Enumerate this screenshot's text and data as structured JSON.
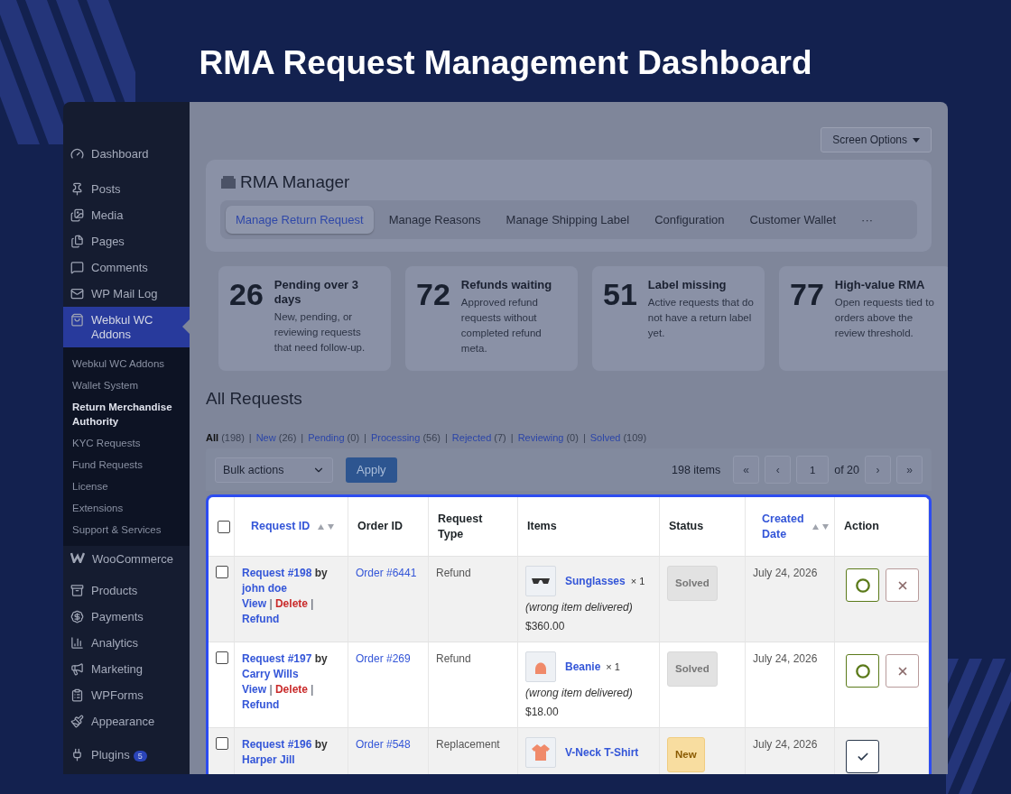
{
  "headline": "RMA Request Management Dashboard",
  "sidebar": {
    "items": [
      {
        "label": "Dashboard",
        "selected": false
      },
      {
        "label": "Posts",
        "selected": false
      },
      {
        "label": "Media",
        "selected": false
      },
      {
        "label": "Pages",
        "selected": false
      },
      {
        "label": "Comments",
        "selected": false
      },
      {
        "label": "WP Mail Log",
        "selected": false
      },
      {
        "label": "Webkul WC Addons",
        "selected": true,
        "children": [
          {
            "label": "Webkul WC Addons",
            "selected": false
          },
          {
            "label": "Wallet System",
            "selected": false
          },
          {
            "label": "Return Merchandise Authority",
            "selected": true
          },
          {
            "label": "KYC Requests",
            "selected": false
          },
          {
            "label": "Fund Requests",
            "selected": false
          },
          {
            "label": "License",
            "selected": false
          },
          {
            "label": "Extensions",
            "selected": false
          },
          {
            "label": "Support & Services",
            "selected": false
          }
        ]
      },
      {
        "label": "WooCommerce",
        "selected": false
      },
      {
        "label": "Products",
        "selected": false
      },
      {
        "label": "Payments",
        "selected": false
      },
      {
        "label": "Analytics",
        "selected": false
      },
      {
        "label": "Marketing",
        "selected": false
      },
      {
        "label": "WPForms",
        "selected": false
      },
      {
        "label": "Appearance",
        "selected": false
      },
      {
        "label": "Plugins",
        "selected": false,
        "badge": "5"
      }
    ]
  },
  "screen_options": "Screen Options",
  "manager": {
    "title": "RMA Manager",
    "tabs": [
      {
        "label": "Manage Return Request",
        "selected": true
      },
      {
        "label": "Manage Reasons",
        "selected": false
      },
      {
        "label": "Manage Shipping Label",
        "selected": false
      },
      {
        "label": "Configuration",
        "selected": false
      },
      {
        "label": "Customer Wallet",
        "selected": false
      },
      {
        "label": "···",
        "selected": false
      }
    ]
  },
  "stats": [
    {
      "value": "26",
      "title": "Pending over 3 days",
      "description": "New, pending, or reviewing requests that need follow-up."
    },
    {
      "value": "72",
      "title": "Refunds waiting",
      "description": "Approved refund requests without completed refund meta."
    },
    {
      "value": "51",
      "title": "Label missing",
      "description": "Active requests that do not have a return label yet."
    },
    {
      "value": "77",
      "title": "High-value RMA",
      "description": "Open requests tied to orders above the review threshold."
    }
  ],
  "section_title": "All Requests",
  "filters": [
    {
      "label": "All",
      "count": "(198)",
      "selected": true
    },
    {
      "separator": "|",
      "label": "New",
      "count": "(26)",
      "selected": false
    },
    {
      "separator": "|",
      "label": "Pending",
      "count": "(0)",
      "selected": false
    },
    {
      "separator": "|",
      "label": "Processing",
      "count": "(56)",
      "selected": false
    },
    {
      "separator": "|",
      "label": "Rejected",
      "count": "(7)",
      "selected": false
    },
    {
      "separator": "|",
      "label": "Reviewing",
      "count": "(0)",
      "selected": false
    },
    {
      "separator": "|",
      "label": "Solved",
      "count": "(109)",
      "selected": false
    }
  ],
  "toolbar": {
    "bulk_actions": "Bulk actions",
    "apply": "Apply",
    "items_count": "198 items",
    "pagination": {
      "first": "«",
      "prev": "‹",
      "page": "1",
      "of": "of 20",
      "next": "›",
      "last": "»"
    }
  },
  "table": {
    "select_all_checked": false,
    "columns": [
      {
        "label": "Request ID",
        "sortable": true
      },
      {
        "label": "Order ID",
        "sortable": false
      },
      {
        "label": "Request Type",
        "sortable": false
      },
      {
        "label": "Items",
        "sortable": false
      },
      {
        "label": "Status",
        "sortable": false
      },
      {
        "label": "Created Date",
        "sortable": true
      },
      {
        "label": "Action",
        "sortable": false
      }
    ],
    "rows": [
      {
        "checked": false,
        "request": "Request #198",
        "by": "by",
        "customer": "john doe",
        "links": [
          {
            "label": "View",
            "kind": "link",
            "after": "|"
          },
          {
            "label": "Delete",
            "kind": "danger",
            "after": "|"
          },
          {
            "label": "Refund",
            "kind": "link"
          }
        ],
        "order": "Order #6441",
        "type": "Refund",
        "item": "Sunglasses",
        "qty": "× 1",
        "reason": "(wrong item delivered)",
        "price": "$360.00",
        "status": {
          "label": "Solved",
          "kind": "solved"
        },
        "date": "July 24, 2026",
        "actions": [
          {
            "kind": "approve"
          },
          {
            "kind": "reject"
          }
        ]
      },
      {
        "checked": false,
        "request": "Request #197",
        "by": "by",
        "customer": "Carry Wills",
        "links": [
          {
            "label": "View",
            "kind": "link",
            "after": "|"
          },
          {
            "label": "Delete",
            "kind": "danger",
            "after": "|"
          },
          {
            "label": "Refund",
            "kind": "link"
          }
        ],
        "order": "Order #269",
        "type": "Refund",
        "item": "Beanie",
        "qty": "× 1",
        "reason": "(wrong item delivered)",
        "price": "$18.00",
        "status": {
          "label": "Solved",
          "kind": "solved"
        },
        "date": "July 24, 2026",
        "actions": [
          {
            "kind": "approve"
          },
          {
            "kind": "reject"
          }
        ]
      },
      {
        "checked": false,
        "request": "Request #196",
        "by": "by",
        "customer": "Harper Jill",
        "order": "Order #548",
        "type": "Replacement",
        "item": "V-Neck T-Shirt",
        "status": {
          "label": "New",
          "kind": "new"
        },
        "date": "July 24, 2026",
        "actions": [
          {
            "kind": "complete"
          }
        ]
      }
    ]
  }
}
